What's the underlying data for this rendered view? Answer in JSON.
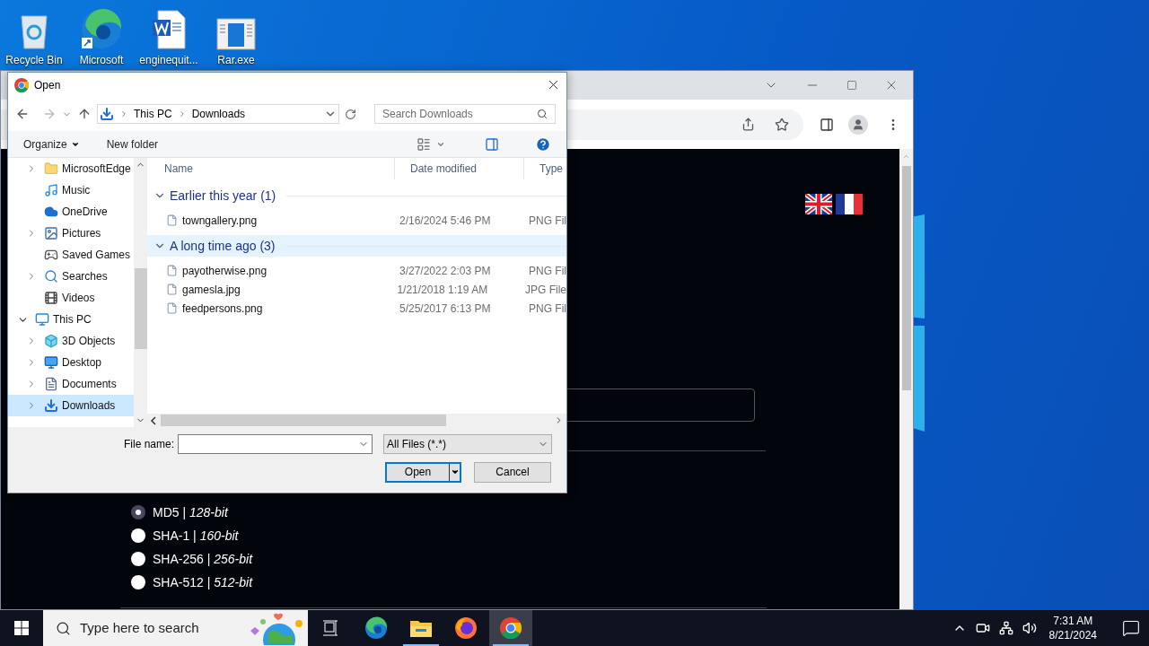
{
  "desktop_icons": [
    {
      "label": "Recycle Bin"
    },
    {
      "label": "Microsoft"
    },
    {
      "label": "enginequit..."
    },
    {
      "label": "Rar.exe"
    }
  ],
  "browser": {
    "hash_options": [
      {
        "label": "MD5 | *128-bit*",
        "selected": true
      },
      {
        "label": "SHA-1 | *160-bit*",
        "selected": false
      },
      {
        "label": "SHA-256 | *256-bit*",
        "selected": false
      },
      {
        "label": "SHA-512 | *512-bit*",
        "selected": false
      }
    ]
  },
  "dialog": {
    "title": "Open",
    "breadcrumb": [
      "This PC",
      "Downloads"
    ],
    "search_placeholder": "Search Downloads",
    "commands": [
      "Organize",
      "New folder"
    ],
    "tree": [
      {
        "label": "MicrosoftEdge",
        "kind": "collapsed",
        "selected": false
      },
      {
        "label": "Music",
        "kind": "leaf",
        "selected": false
      },
      {
        "label": "OneDrive",
        "kind": "leaf",
        "selected": false
      },
      {
        "label": "Pictures",
        "kind": "collapsed",
        "selected": false
      },
      {
        "label": "Saved Games",
        "kind": "leaf",
        "selected": false
      },
      {
        "label": "Searches",
        "kind": "collapsed",
        "selected": false
      },
      {
        "label": "Videos",
        "kind": "leaf",
        "selected": false
      },
      {
        "label": "This PC",
        "kind": "expanded",
        "selected": false,
        "children": [
          {
            "label": "3D Objects",
            "kind": "collapsed",
            "selected": false
          },
          {
            "label": "Desktop",
            "kind": "collapsed",
            "selected": false
          },
          {
            "label": "Documents",
            "kind": "collapsed",
            "selected": false
          },
          {
            "label": "Downloads",
            "kind": "collapsed",
            "selected": true
          }
        ]
      }
    ],
    "columns": [
      "Name",
      "Date modified",
      "Type"
    ],
    "groups": [
      {
        "label": "Earlier this year (1)",
        "selected": false,
        "files": [
          {
            "name": "towngallery.png",
            "date": "2/16/2024 5:46 PM",
            "type": "PNG Fil"
          }
        ]
      },
      {
        "label": "A long time ago (3)",
        "selected": true,
        "files": [
          {
            "name": "payotherwise.png",
            "date": "3/27/2022 2:03 PM",
            "type": "PNG Fil"
          },
          {
            "name": "gamesla.jpg",
            "date": "1/21/2018 1:19 AM",
            "type": "JPG File"
          },
          {
            "name": "feedpersons.png",
            "date": "5/25/2017 6:13 PM",
            "type": "PNG Fil"
          }
        ]
      }
    ],
    "file_name_label": "File name:",
    "file_type": "All Files (*.*)",
    "buttons": [
      "Open",
      "Cancel"
    ]
  },
  "taskbar": {
    "search_placeholder": "Type here to search",
    "apps": [
      {
        "kind": "taskview",
        "running": false,
        "selected": false
      },
      {
        "kind": "edge",
        "running": false,
        "selected": false
      },
      {
        "kind": "explorer",
        "running": true,
        "selected": false
      },
      {
        "kind": "firefox",
        "running": false,
        "selected": false
      },
      {
        "kind": "chrome",
        "running": true,
        "selected": true
      }
    ],
    "time": "7:31 AM",
    "date": "8/21/2024"
  }
}
